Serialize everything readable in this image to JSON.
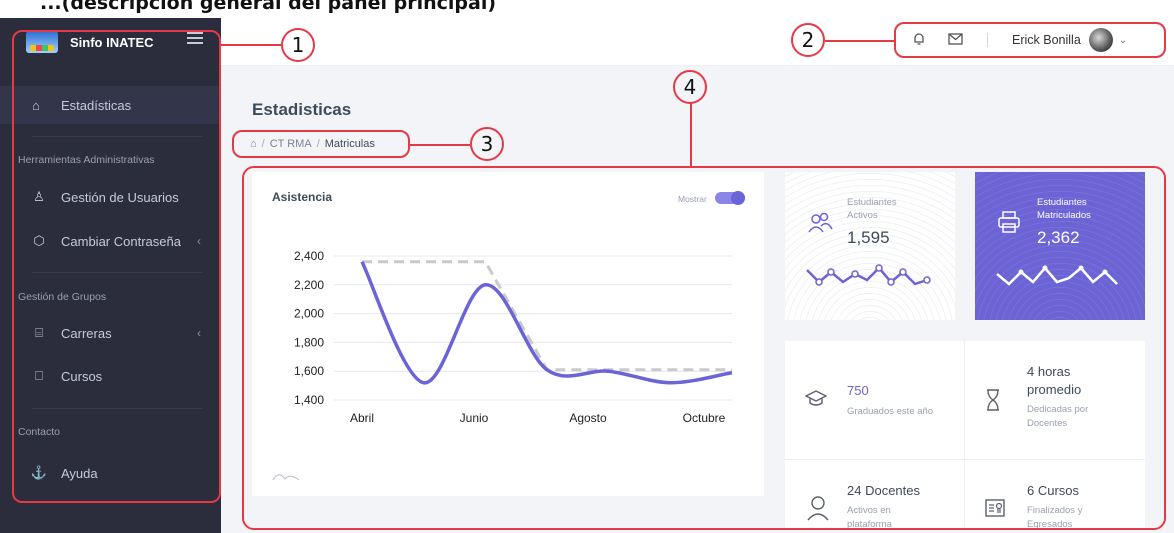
{
  "caption": "...(descripcion general del panel principal)",
  "app": {
    "brand": "Sinfo INATEC"
  },
  "sidebar": {
    "active": {
      "label": "Estadísticas",
      "icon": "home-icon"
    },
    "sections": [
      {
        "title": "Herramientas Administrativas"
      },
      {
        "title": "Gestión de Grupos"
      },
      {
        "title": "Contacto"
      }
    ],
    "items": [
      {
        "label": "Gestión de Usuarios",
        "icon": "user-icon"
      },
      {
        "label": "Cambiar Contraseña",
        "icon": "box-icon",
        "chevron": "‹"
      },
      {
        "label": "Carreras",
        "icon": "briefcase-icon",
        "chevron": "‹"
      },
      {
        "label": "Cursos",
        "icon": "bookmark-icon"
      },
      {
        "label": "Ayuda",
        "icon": "anchor-icon"
      }
    ]
  },
  "topbar": {
    "user_name": "Erick Bonilla",
    "icons": [
      "bell-icon",
      "mail-icon"
    ]
  },
  "page": {
    "title": "Estadisticas",
    "breadcrumb": [
      "CT RMA",
      "Matriculas"
    ]
  },
  "chart_card": {
    "title": "Asistencia",
    "toggle_label": "Mostrar"
  },
  "chart_data": {
    "type": "line",
    "categories": [
      "Abril",
      "Junio",
      "Agosto",
      "Octubre"
    ],
    "ylim": [
      1400,
      2400
    ],
    "yticks": [
      "2,400",
      "2,200",
      "2,000",
      "1,800",
      "1,600",
      "1,400"
    ],
    "series": [
      {
        "values": [
          2360,
          1520,
          2200,
          1610,
          1600,
          1520,
          1590
        ],
        "x_positions": [
          0,
          0.5,
          1,
          1.5,
          2,
          2.5,
          3
        ],
        "color": "#6b63d8",
        "style": "solid"
      },
      {
        "values": [
          2360,
          2360,
          2360,
          1610,
          1610,
          1610,
          1610
        ],
        "x_positions": [
          0,
          0.5,
          1,
          1.5,
          2,
          2.5,
          3
        ],
        "color": "#c9c9cf",
        "style": "dashed"
      }
    ]
  },
  "stats": {
    "activos": {
      "label1": "Estudiantes",
      "label2": "Activos",
      "value": "1,595",
      "icon": "users-icon"
    },
    "matriculados": {
      "label1": "Estudiantes",
      "label2": "Matriculados",
      "value": "2,362",
      "icon": "printer-icon"
    }
  },
  "grid": {
    "graduados": {
      "value": "750",
      "sub": "Graduados este año",
      "icon": "graduation-cap-icon"
    },
    "horas": {
      "title1": "4 horas",
      "title2": "promedio",
      "sub1": "Dedicadas por",
      "sub2": "Docentes",
      "icon": "hourglass-icon"
    },
    "docentes": {
      "title": "24 Docentes",
      "sub1": "Activos en",
      "sub2": "plataforma",
      "icon": "person-icon"
    },
    "cursos": {
      "title": "6 Cursos",
      "sub1": "Finalizados y",
      "sub2": "Egresados",
      "icon": "certificate-icon"
    }
  },
  "callouts": [
    "1",
    "2",
    "3",
    "4"
  ],
  "colors": {
    "accent": "#6c63d4",
    "sidebar": "#2b2d3c",
    "annotation": "#e63946"
  }
}
